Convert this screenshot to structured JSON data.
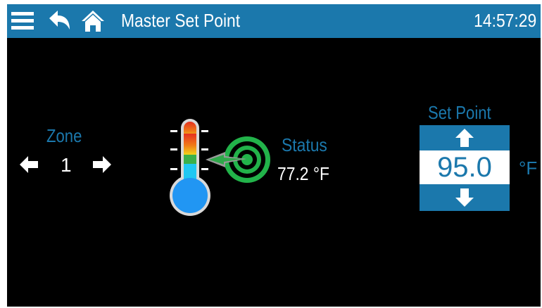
{
  "header": {
    "title": "Master Set Point",
    "clock": "14:57:29",
    "menu_icon": "hamburger-menu-icon",
    "back_icon": "back-arrow-icon",
    "home_icon": "home-icon"
  },
  "zone": {
    "label": "Zone",
    "value": "1",
    "prev_icon": "left-arrow-icon",
    "next_icon": "right-arrow-icon"
  },
  "status": {
    "label": "Status",
    "value": "77.2 °F"
  },
  "set_point": {
    "label": "Set Point",
    "value": "95.0",
    "unit": "°F",
    "up_icon": "up-arrow-icon",
    "down_icon": "down-arrow-icon"
  },
  "colors": {
    "accent": "#1b78ac",
    "background": "#000000",
    "target_green": "#22b34a",
    "thermo_blue": "#2196f3"
  }
}
